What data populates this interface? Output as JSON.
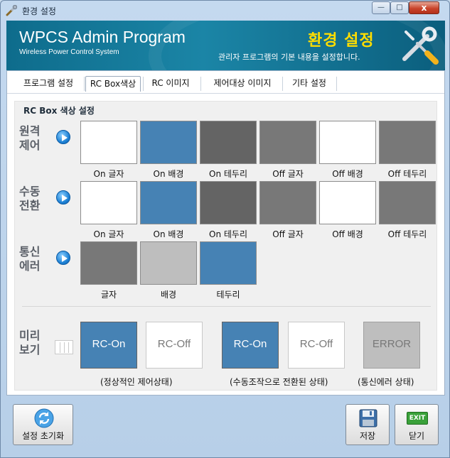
{
  "window": {
    "title": "환경 설정",
    "minimize": "—",
    "maximize": "□",
    "close": "x"
  },
  "banner": {
    "brand": "WPCS Admin Program",
    "brand_sub": "Wireless Power Control System",
    "title": "환경 설정",
    "description": "관리자 프로그램의 기본 내용을 설정합니다."
  },
  "tabs": [
    "프로그램 설정",
    "RC Box색상",
    "RC 이미지",
    "제어대상 이미지",
    "기타 설정"
  ],
  "active_tab": "RC Box색상",
  "group_title": "RC Box 색상 설정",
  "rows": [
    {
      "label_line1": "원격",
      "label_line2": "제어",
      "swatches": [
        {
          "label": "On 글자",
          "color": "#ffffff"
        },
        {
          "label": "On 배경",
          "color": "#4682b4"
        },
        {
          "label": "On 테두리",
          "color": "#646464"
        },
        {
          "label": "Off 글자",
          "color": "#787878"
        },
        {
          "label": "Off 배경",
          "color": "#ffffff"
        },
        {
          "label": "Off 테두리",
          "color": "#787878"
        }
      ]
    },
    {
      "label_line1": "수동",
      "label_line2": "전환",
      "swatches": [
        {
          "label": "On 글자",
          "color": "#ffffff"
        },
        {
          "label": "On 배경",
          "color": "#4682b4"
        },
        {
          "label": "On 테두리",
          "color": "#646464"
        },
        {
          "label": "Off 글자",
          "color": "#787878"
        },
        {
          "label": "Off 배경",
          "color": "#ffffff"
        },
        {
          "label": "Off 테두리",
          "color": "#787878"
        }
      ]
    },
    {
      "label_line1": "통신",
      "label_line2": "에러",
      "swatches": [
        {
          "label": "글자",
          "color": "#787878"
        },
        {
          "label": "배경",
          "color": "#bebebe"
        },
        {
          "label": "테두리",
          "color": "#4682b4"
        }
      ]
    }
  ],
  "preview": {
    "label_line1": "미리",
    "label_line2": "보기",
    "boxes": [
      {
        "text": "RC-On",
        "bg": "#4682b4",
        "fg": "#ffffff",
        "border": "#646464"
      },
      {
        "text": "RC-Off",
        "bg": "#ffffff",
        "fg": "#787878",
        "border": "#c8c8c8"
      },
      {
        "text": "RC-On",
        "bg": "#4682b4",
        "fg": "#ffffff",
        "border": "#646464"
      },
      {
        "text": "RC-Off",
        "bg": "#ffffff",
        "fg": "#787878",
        "border": "#c8c8c8"
      },
      {
        "text": "ERROR",
        "bg": "#bebebe",
        "fg": "#787878",
        "border": "#a0a0a0"
      }
    ],
    "captions": [
      "(정상적인 제어상태)",
      "(수동조작으로 전환된 상태)",
      "(통신에러 상태)"
    ]
  },
  "buttons": {
    "reset": "설정 초기화",
    "save": "저장",
    "close": "닫기",
    "exit_badge": "EXIT"
  }
}
